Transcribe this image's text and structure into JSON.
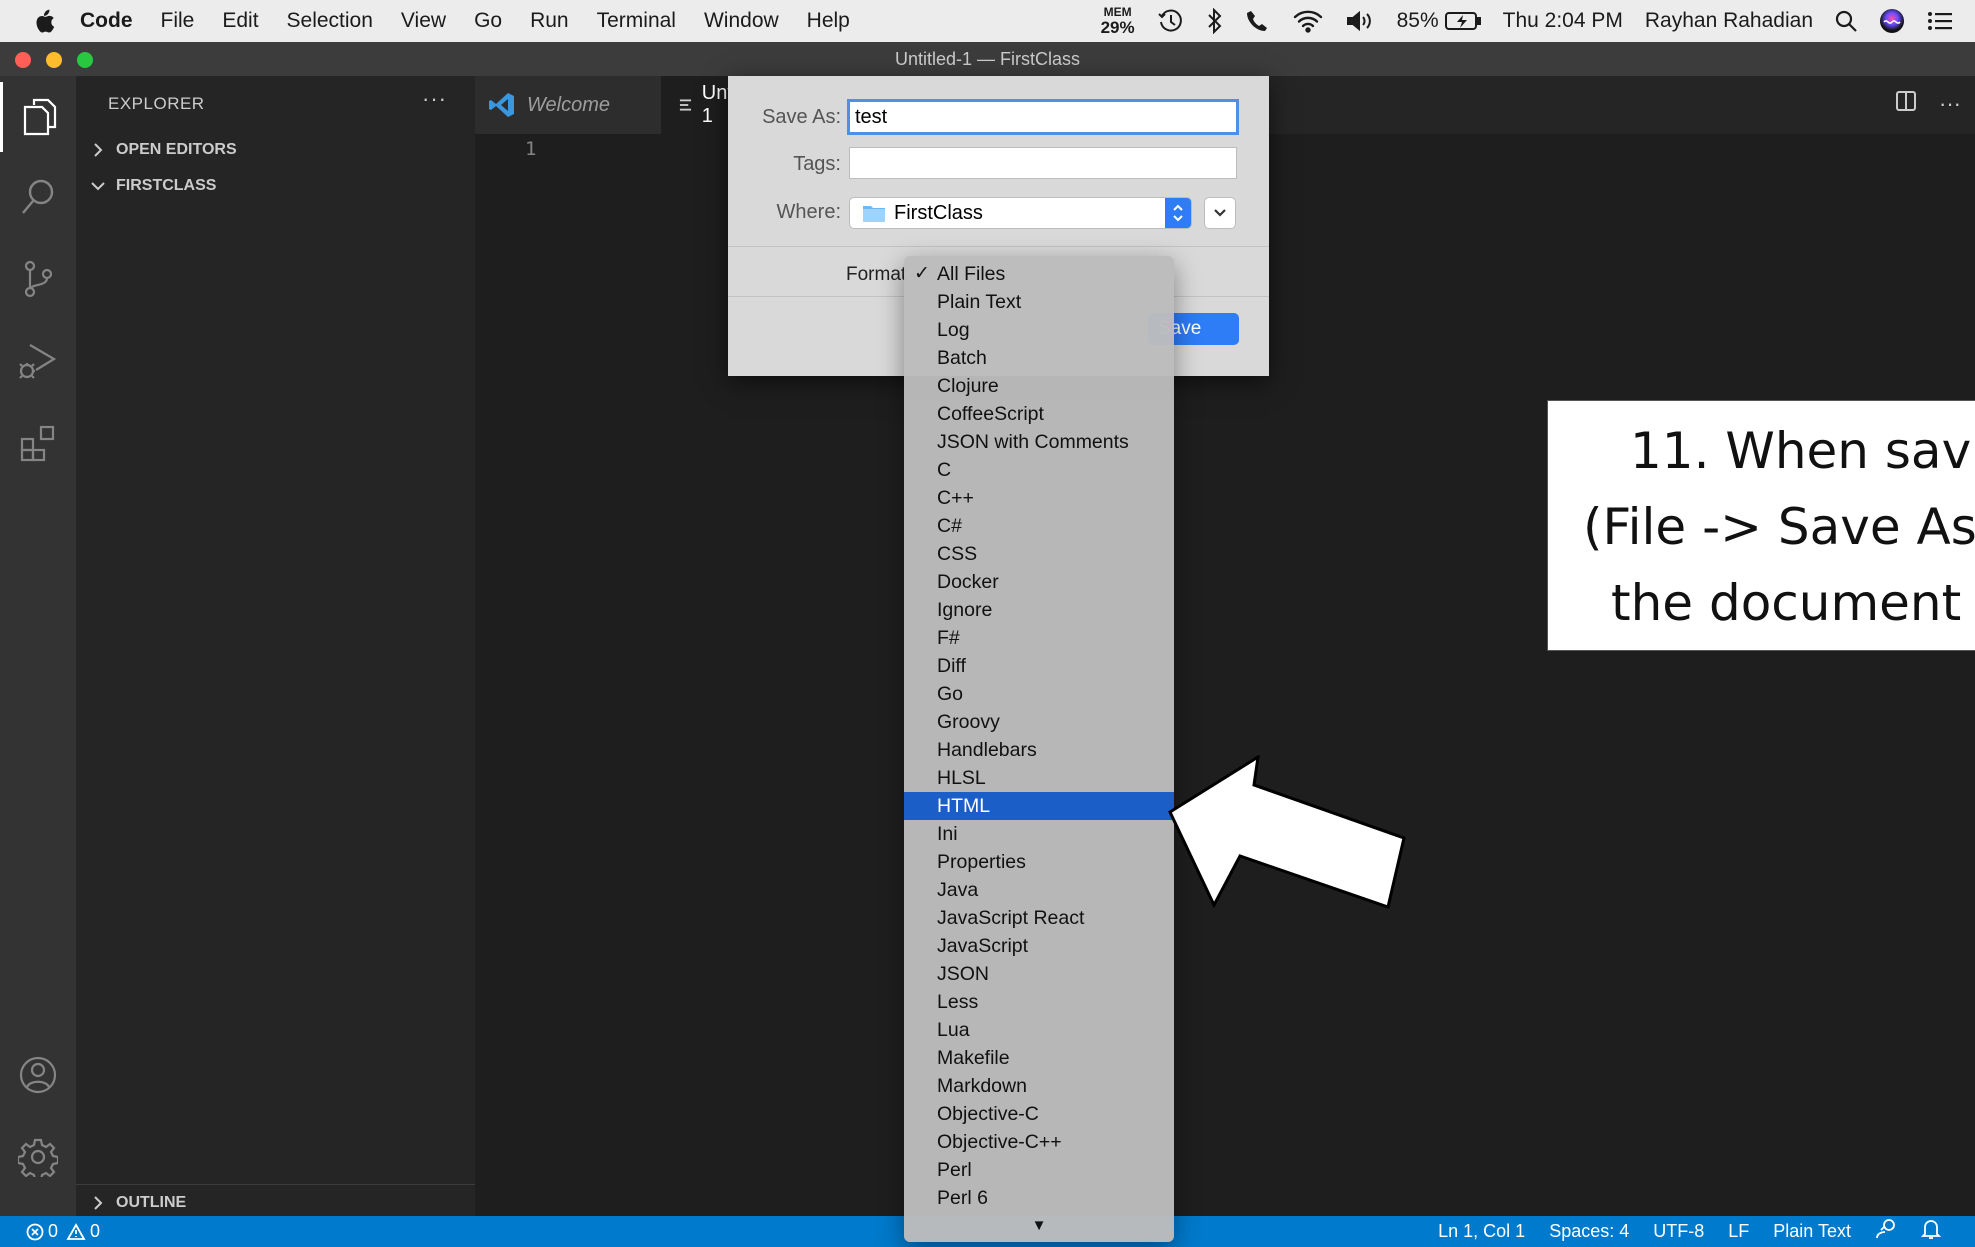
{
  "menubar": {
    "app": "Code",
    "menus": [
      "File",
      "Edit",
      "Selection",
      "View",
      "Go",
      "Run",
      "Terminal",
      "Window",
      "Help"
    ],
    "mem_label": "MEM",
    "mem_value": "29%",
    "battery": "85%",
    "clock": "Thu 2:04 PM",
    "user": "Rayhan Rahadian"
  },
  "window": {
    "title": "Untitled-1 — FirstClass"
  },
  "sidebar": {
    "title": "EXPLORER",
    "more": "···",
    "sections": [
      "OPEN EDITORS",
      "FIRSTCLASS"
    ],
    "outline": "OUTLINE"
  },
  "editor": {
    "tabs": [
      "Welcome",
      "Untitled-1"
    ],
    "line_number": "1",
    "more": "···"
  },
  "save_dialog": {
    "save_as_label": "Save As:",
    "save_as_value": "test",
    "tags_label": "Tags:",
    "tags_value": "",
    "where_label": "Where:",
    "where_value": "FirstClass",
    "format_label": "Format",
    "save_button": "Save"
  },
  "format_menu": {
    "options": [
      "All Files",
      "Plain Text",
      "Log",
      "Batch",
      "Clojure",
      "CoffeeScript",
      "JSON with Comments",
      "C",
      "C++",
      "C#",
      "CSS",
      "Docker",
      "Ignore",
      "F#",
      "Diff",
      "Go",
      "Groovy",
      "Handlebars",
      "HLSL",
      "HTML",
      "Ini",
      "Properties",
      "Java",
      "JavaScript React",
      "JavaScript",
      "JSON",
      "Less",
      "Lua",
      "Makefile",
      "Markdown",
      "Objective-C",
      "Objective-C++",
      "Perl",
      "Perl 6"
    ],
    "checked": "All Files",
    "highlighted": "HTML",
    "scroll_indicator": "▼"
  },
  "statusbar": {
    "errors": "0",
    "warnings": "0",
    "position": "Ln 1, Col 1",
    "spaces": "Spaces: 4",
    "encoding": "UTF-8",
    "eol": "LF",
    "language": "Plain Text"
  },
  "callout": {
    "lines": [
      "11. When sav",
      "(File -> Save As)",
      "the document"
    ]
  },
  "colors": {
    "accent": "#007acc",
    "selection": "#1c5ec7",
    "dialog_button": "#2e7cf6"
  }
}
